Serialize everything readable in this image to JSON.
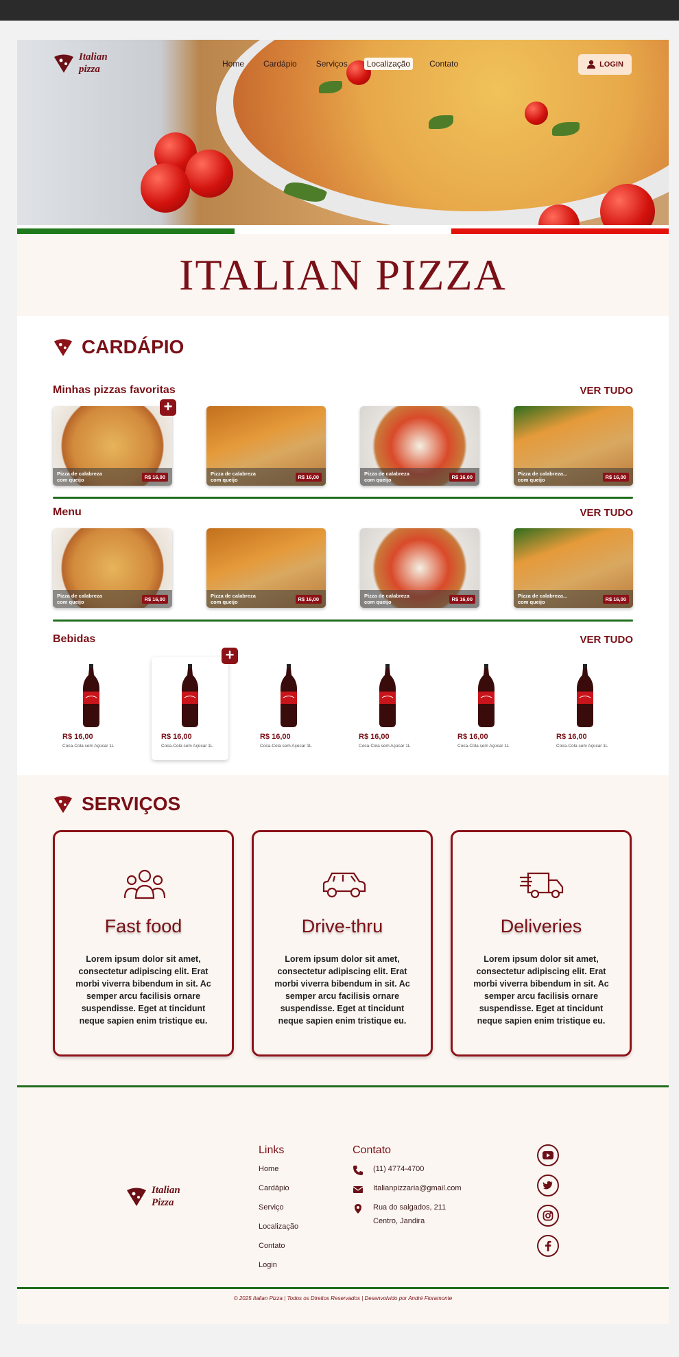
{
  "brand": {
    "name_line1": "Italian",
    "name_line2": "pizza",
    "footer_line1": "Italian",
    "footer_line2": "Pizza"
  },
  "nav": {
    "items": [
      "Home",
      "Cardápio",
      "Serviços",
      "Localização",
      "Contato"
    ],
    "active": "Localização",
    "login_label": "LOGIN"
  },
  "hero": {
    "title": "ITALIAN PIZZA"
  },
  "menu_section": {
    "title": "CARDÁPIO",
    "see_all": "VER TUDO",
    "rows": [
      {
        "title": "Minhas pizzas favoritas",
        "items": [
          {
            "name": "Pizza de calabreza com queijo",
            "price": "R$ 16,00"
          },
          {
            "name": "Pizza de calabreza com queijo",
            "price": "R$ 16,00"
          },
          {
            "name": "Pizza de calabreza com queijo",
            "price": "R$ 16,00"
          },
          {
            "name": "Pizza de calabreza... com queijo",
            "price": "R$ 16,00"
          }
        ]
      },
      {
        "title": "Menu",
        "items": [
          {
            "name": "Pizza de calabreza com queijo",
            "price": "R$ 16,00"
          },
          {
            "name": "Pizza de calabreza com queijo",
            "price": "R$ 16,00"
          },
          {
            "name": "Pizza de calabreza com queijo",
            "price": "R$ 16,00"
          },
          {
            "name": "Pizza de calabreza... com queijo",
            "price": "R$ 16,00"
          }
        ]
      }
    ],
    "drinks": {
      "title": "Bebidas",
      "items": [
        {
          "price": "R$ 16,00",
          "name": "Coca-Cola sem Açúcar 1L"
        },
        {
          "price": "R$ 16,00",
          "name": "Coca-Cola sem Açúcar 1L"
        },
        {
          "price": "R$ 16,00",
          "name": "Coca-Cola sem Açúcar 1L"
        },
        {
          "price": "R$ 16,00",
          "name": "Coca-Cola sem Açúcar 1L"
        },
        {
          "price": "R$ 16,00",
          "name": "Coca-Cola sem Açúcar 1L"
        },
        {
          "price": "R$ 16,00",
          "name": "Coca-Cola sem Açúcar 1L"
        }
      ]
    }
  },
  "services": {
    "title": "SERVIÇOS",
    "items": [
      {
        "title": "Fast food",
        "icon": "people-group-icon",
        "text": "Lorem ipsum dolor sit amet, consectetur adipiscing elit. Erat morbi viverra bibendum in sit. Ac semper arcu facilisis ornare suspendisse. Eget at tincidunt neque sapien enim tristique eu."
      },
      {
        "title": "Drive-thru",
        "icon": "car-icon",
        "text": "Lorem ipsum dolor sit amet, consectetur adipiscing elit. Erat morbi viverra bibendum in sit. Ac semper arcu facilisis ornare suspendisse. Eget at tincidunt neque sapien enim tristique eu."
      },
      {
        "title": "Deliveries",
        "icon": "delivery-truck-icon",
        "text": "Lorem ipsum dolor sit amet, consectetur adipiscing elit. Erat morbi viverra bibendum in sit. Ac semper arcu facilisis ornare suspendisse. Eget at tincidunt neque sapien enim tristique eu."
      }
    ]
  },
  "footer": {
    "links_title": "Links",
    "links": [
      "Home",
      "Cardápio",
      "Serviço",
      "Localização",
      "Contato",
      "Login"
    ],
    "contact_title": "Contato",
    "phone": "(11) 4774-4700",
    "email": "Italianpizzaria@gmail.com",
    "address_line1": "Rua do salgados, 211",
    "address_line2": "Centro, Jandira",
    "social": [
      "youtube-icon",
      "twitter-icon",
      "instagram-icon",
      "facebook-icon"
    ],
    "copyright": "© 2025 Italian Pizza | Todos os Direitos Reservados | Desenvolvido por André Fioramonte"
  },
  "colors": {
    "brand": "#7a1017",
    "green": "#1f6d1d",
    "cream": "#fcf6f2",
    "flag_red": "#e3120b"
  }
}
